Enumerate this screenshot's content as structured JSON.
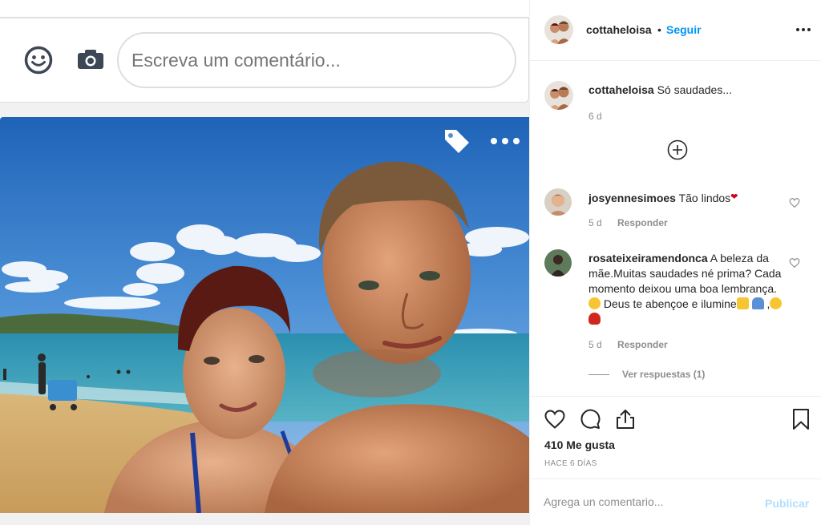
{
  "embedded_comment_bar": {
    "placeholder": "Escreva um comentário..."
  },
  "post": {
    "username": "cottaheloisa",
    "dot": "•",
    "follow_label": "Seguir",
    "caption_user": "cottaheloisa",
    "caption_text": "Só saudades...",
    "caption_age": "6 d"
  },
  "comments": [
    {
      "user": "josyennesimoes",
      "text": "Tão lindos",
      "emoji": "❤",
      "age": "5 d",
      "reply_label": "Responder"
    },
    {
      "user": "rosateixeiramendonca",
      "text": "A beleza da mãe.Muitas saudades né prima? Cada momento deixou uma boa lembrança.",
      "text2": "Deus te abençoe e ilumine",
      "text3": ",",
      "age": "5 d",
      "reply_label": "Responder",
      "view_replies": "Ver respuestas (1)"
    }
  ],
  "footer": {
    "likes": "410 Me gusta",
    "posted": "HACE 6 DÍAS",
    "add_placeholder": "Agrega un comentario...",
    "publish_label": "Publicar"
  },
  "icons": {
    "emoji": "smiley-icon",
    "camera": "camera-icon",
    "tag": "tag-icon",
    "more": "more-icon",
    "load_more": "plus-circle-icon",
    "heart": "heart-icon",
    "comment": "comment-icon",
    "share": "share-icon",
    "save": "bookmark-icon"
  },
  "colors": {
    "follow": "#0095f6",
    "publish_disabled": "#b2dffc",
    "muted": "#8e8e8e",
    "text": "#262626"
  }
}
